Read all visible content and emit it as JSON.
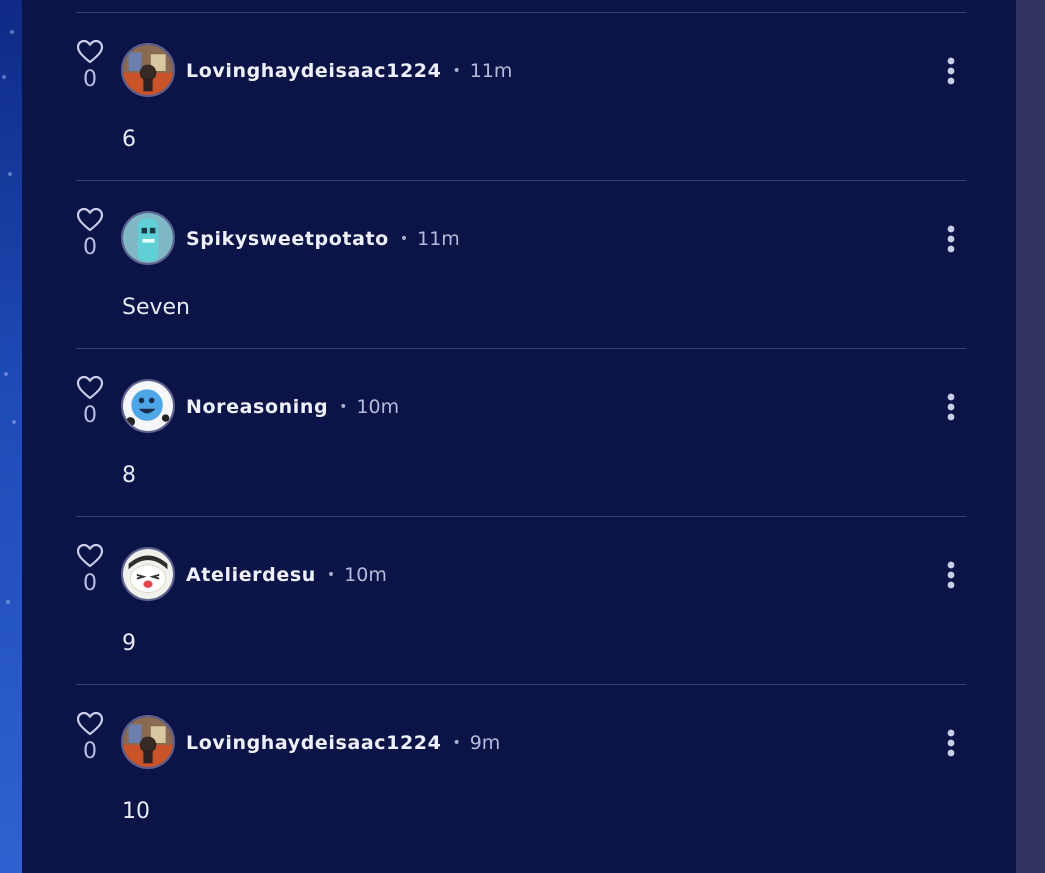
{
  "comments": [
    {
      "username": "Lovinghaydeisaac1224",
      "time": "11m",
      "likes": "0",
      "text": "6",
      "avatar": "avatar-orange"
    },
    {
      "username": "Spikysweetpotato",
      "time": "11m",
      "likes": "0",
      "text": "Seven",
      "avatar": "avatar-teal"
    },
    {
      "username": "Noreasoning",
      "time": "10m",
      "likes": "0",
      "text": "8",
      "avatar": "avatar-blue-face"
    },
    {
      "username": "Atelierdesu",
      "time": "10m",
      "likes": "0",
      "text": "9",
      "avatar": "avatar-cat-face"
    },
    {
      "username": "Lovinghaydeisaac1224",
      "time": "9m",
      "likes": "0",
      "text": "10",
      "avatar": "avatar-orange"
    }
  ],
  "separator": "•",
  "colors": {
    "background": "#0c1347",
    "divider": "#3a4174",
    "username": "#eef0fb",
    "meta": "#b5bbd9",
    "icon": "#c9cde6",
    "scroll_track": "#30345f"
  }
}
